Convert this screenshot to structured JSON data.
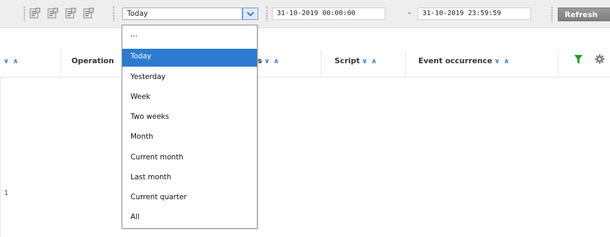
{
  "toolbar": {
    "icons": [
      "report-icon",
      "report-icon",
      "report-icon",
      "report-icon"
    ],
    "period_value": "Today",
    "date_from": "31-10-2019 00:00:00",
    "date_separator": "-",
    "date_to": "31-10-2019 23:59:59",
    "refresh_label": "Refresh"
  },
  "columns": [
    {
      "label": "",
      "sort": "∨ ∧"
    },
    {
      "label": "Operation",
      "sort": ""
    },
    {
      "label": "s",
      "sort": "∨ ∧"
    },
    {
      "label": "Script",
      "sort": "∨ ∧"
    },
    {
      "label": "Event occurrence",
      "sort": "∨ ∧"
    }
  ],
  "actions": {
    "filter_icon": "filter-icon",
    "settings_icon": "gear-icon"
  },
  "row_marker": "1",
  "dropdown": {
    "selected": "Today",
    "options": [
      "...",
      "Today",
      "Yesterday",
      "Week",
      "Two weeks",
      "Month",
      "Current month",
      "Last month",
      "Current quarter",
      "All"
    ]
  },
  "colors": {
    "accent": "#2c7bd0",
    "sort_arrow": "#3d7fcf",
    "filter": "#1e9b2a",
    "refresh_bg": "#8a8a8a"
  }
}
